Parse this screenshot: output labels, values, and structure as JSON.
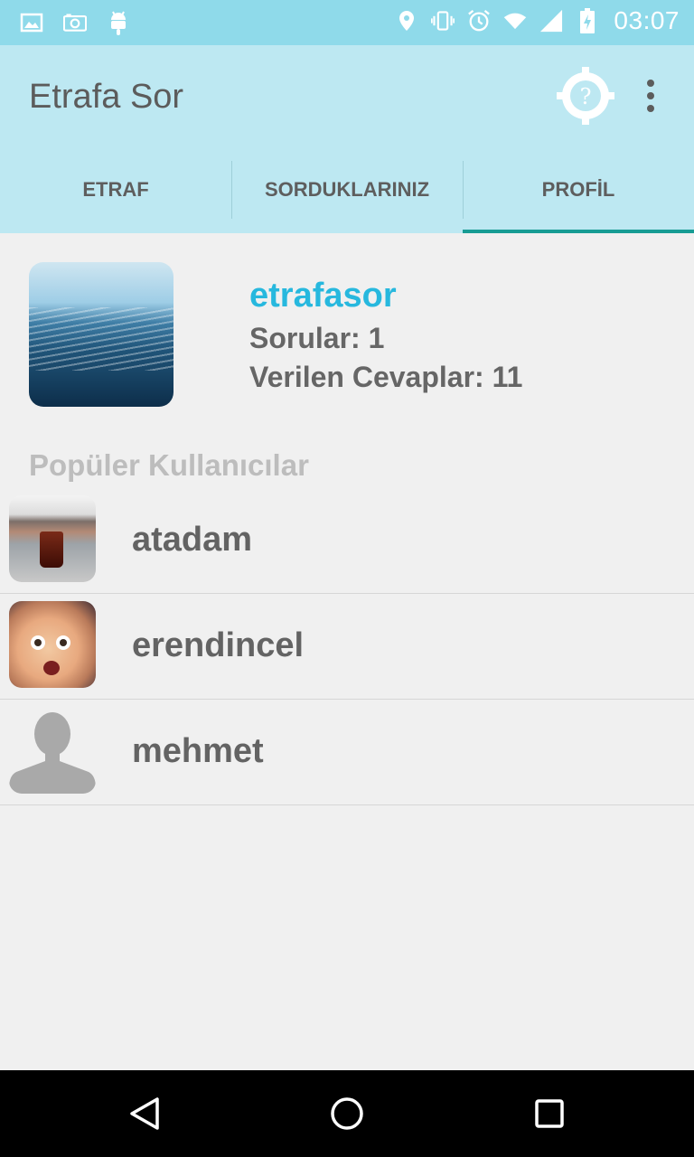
{
  "status_bar": {
    "time": "03:07",
    "left_icons": [
      "image-notification-icon",
      "camera-notification-icon",
      "android-notification-icon"
    ],
    "right_icons": [
      "location-icon",
      "vibrate-icon",
      "alarm-icon",
      "wifi-icon",
      "signal-icon",
      "battery-charging-icon"
    ]
  },
  "app_bar": {
    "title": "Etrafa Sor",
    "actions": [
      "help-target-icon",
      "overflow-menu-icon"
    ]
  },
  "tabs": [
    {
      "label": "ETRAF",
      "active": false
    },
    {
      "label": "SORDUKLARINIZ",
      "active": false
    },
    {
      "label": "PROFİL",
      "active": true
    }
  ],
  "profile": {
    "username": "etrafasor",
    "questions": "Sorular: 1",
    "answers": "Verilen Cevaplar: 11"
  },
  "popular_users": {
    "title": "Popüler Kullanıcılar",
    "items": [
      {
        "name": "atadam"
      },
      {
        "name": "erendincel"
      },
      {
        "name": "mehmet"
      }
    ]
  },
  "colors": {
    "status_bar": "#8fdaea",
    "app_bar": "#bde8f2",
    "tab_indicator": "#179c94",
    "username": "#27b8de"
  },
  "nav_bar": {
    "buttons": [
      "back-icon",
      "home-icon",
      "recents-icon"
    ]
  }
}
